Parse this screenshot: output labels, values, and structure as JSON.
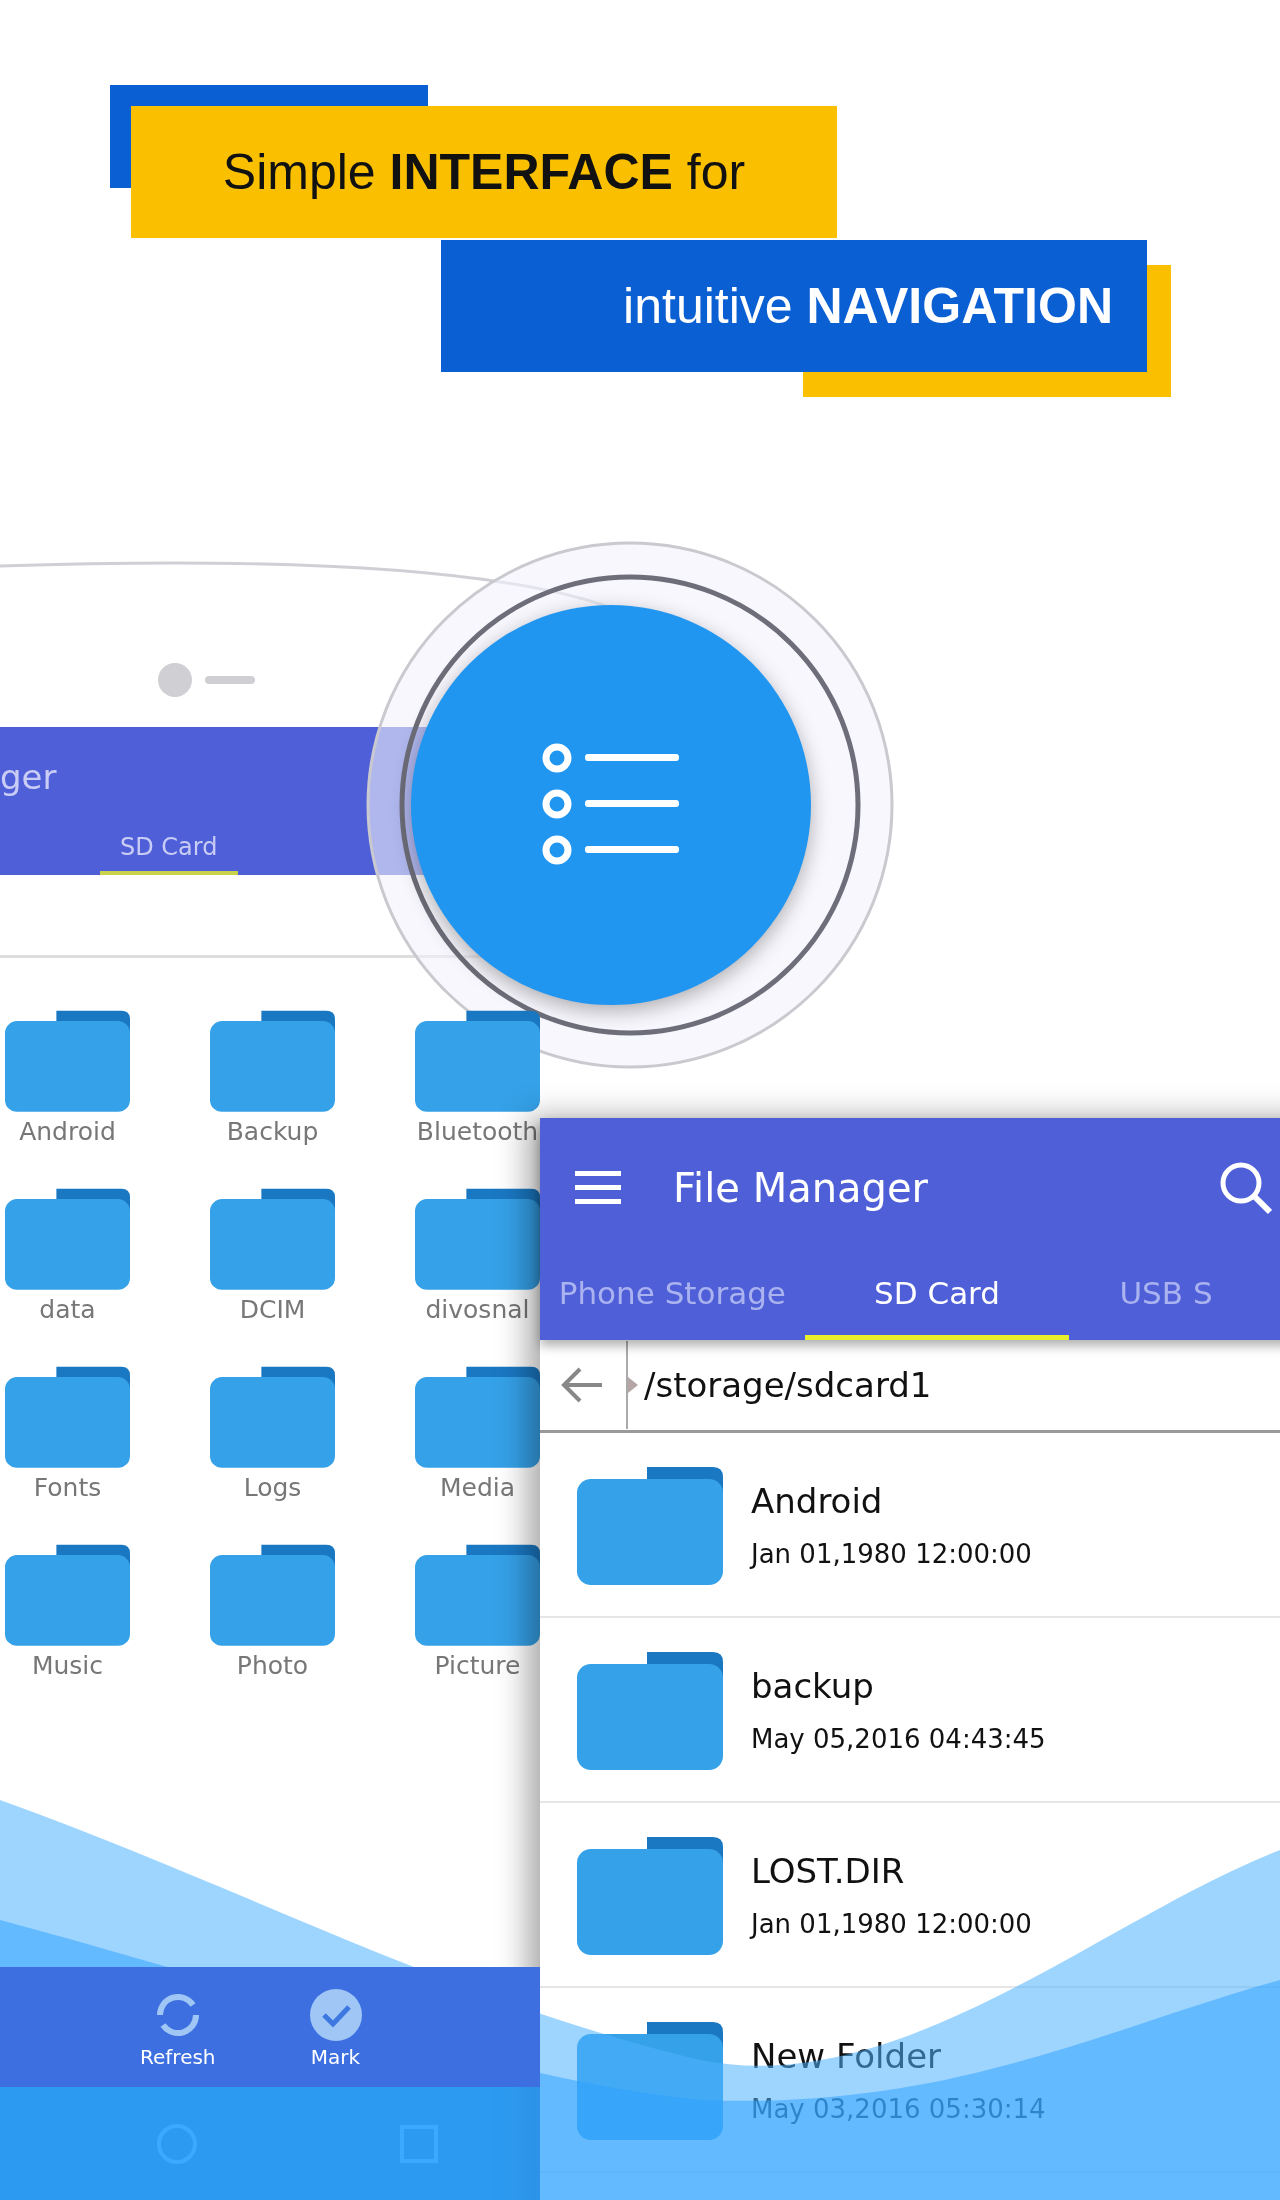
{
  "headline": {
    "line_1": "Simple **INTERFACE** for",
    "line_2": "intuitive **NAVIGATION**"
  },
  "back_phone": {
    "title": "ger",
    "tab": "SD Card",
    "folders": [
      "Android",
      "Backup",
      "Bluetooth",
      "data",
      "DCIM",
      "divosnal",
      "Fonts",
      "Logs",
      "Media",
      "Music",
      "Photo",
      "Picture"
    ],
    "bottom_bar": [
      "Refresh",
      "Mark"
    ]
  },
  "front_phone": {
    "title": "File Manager",
    "tabs": [
      {
        "label": "Phone Storage",
        "selected": false
      },
      {
        "label": "SD Card",
        "selected": true
      },
      {
        "label": "USB S",
        "selected": false
      }
    ],
    "path": "/storage/sdcard1",
    "files": [
      {
        "name": "Android",
        "date": "Jan 01,1980 12:00:00"
      },
      {
        "name": "backup",
        "date": "May 05,2016 04:43:45"
      },
      {
        "name": "LOST.DIR",
        "date": "Jan 01,1980 12:00:00"
      },
      {
        "name": "New Folder",
        "date": "May 03,2016 05:30:14"
      }
    ]
  }
}
